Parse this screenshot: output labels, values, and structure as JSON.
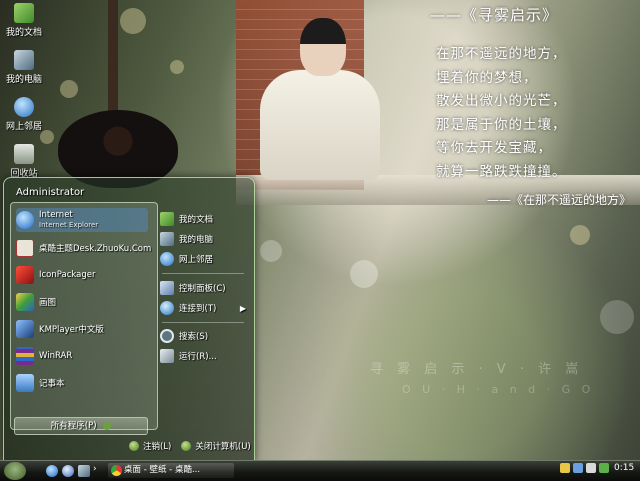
{
  "desktop": {
    "icons": [
      {
        "label": "我的文档",
        "icon": "my-documents-icon"
      },
      {
        "label": "我的电脑",
        "icon": "my-computer-icon"
      },
      {
        "label": "网上邻居",
        "icon": "network-icon"
      },
      {
        "label": "回收站",
        "icon": "recycle-bin-icon"
      }
    ]
  },
  "wallpaper": {
    "poem_title": "——《寻雾启示》",
    "poem_lines": [
      "在那不遥远的地方，",
      "埋着你的梦想，",
      "散发出微小的光芒，",
      "那是属于你的土壤，",
      "等你去开发宝藏，",
      "就算一路跌跌撞撞。"
    ],
    "poem_signature": "——《在那不遥远的地方》",
    "watermark": "寻 雾 启 示 · V · 许 嵩",
    "watermark_sub": "O U · H · a n d · G O"
  },
  "start_menu": {
    "user": "Administrator",
    "left_items": [
      {
        "label": "Internet",
        "sub": "Internet Explorer",
        "icon": "internet-explorer-icon"
      },
      {
        "label": "桌酷主题Desk.ZhuoKu.Com",
        "icon": "zhuoku-icon"
      },
      {
        "label": "IconPackager",
        "icon": "iconpackager-icon"
      },
      {
        "label": "画图",
        "icon": "paint-icon"
      },
      {
        "label": "KMPlayer中文版",
        "icon": "kmplayer-icon"
      },
      {
        "label": "WinRAR",
        "icon": "winrar-icon"
      },
      {
        "label": "记事本",
        "icon": "notepad-icon"
      }
    ],
    "all_programs": "所有程序(P)",
    "right_items": [
      {
        "label": "我的文档",
        "icon": "my-documents-icon"
      },
      {
        "label": "我的电脑",
        "icon": "my-computer-icon"
      },
      {
        "label": "网上邻居",
        "icon": "network-icon"
      },
      {
        "label": "控制面板(C)",
        "icon": "control-panel-icon"
      },
      {
        "label": "连接到(T)",
        "icon": "connect-icon"
      },
      {
        "label": "搜索(S)",
        "icon": "search-icon"
      },
      {
        "label": "运行(R)...",
        "icon": "run-icon"
      }
    ],
    "logoff": "注销(L)",
    "shutdown": "关闭计算机(U)"
  },
  "taskbar": {
    "task_label": "桌面 - 壁纸 - 桌酷...",
    "clock": "0:15"
  },
  "colors": {
    "menu_border": "#bee6aa",
    "taskbar": "#161814"
  }
}
